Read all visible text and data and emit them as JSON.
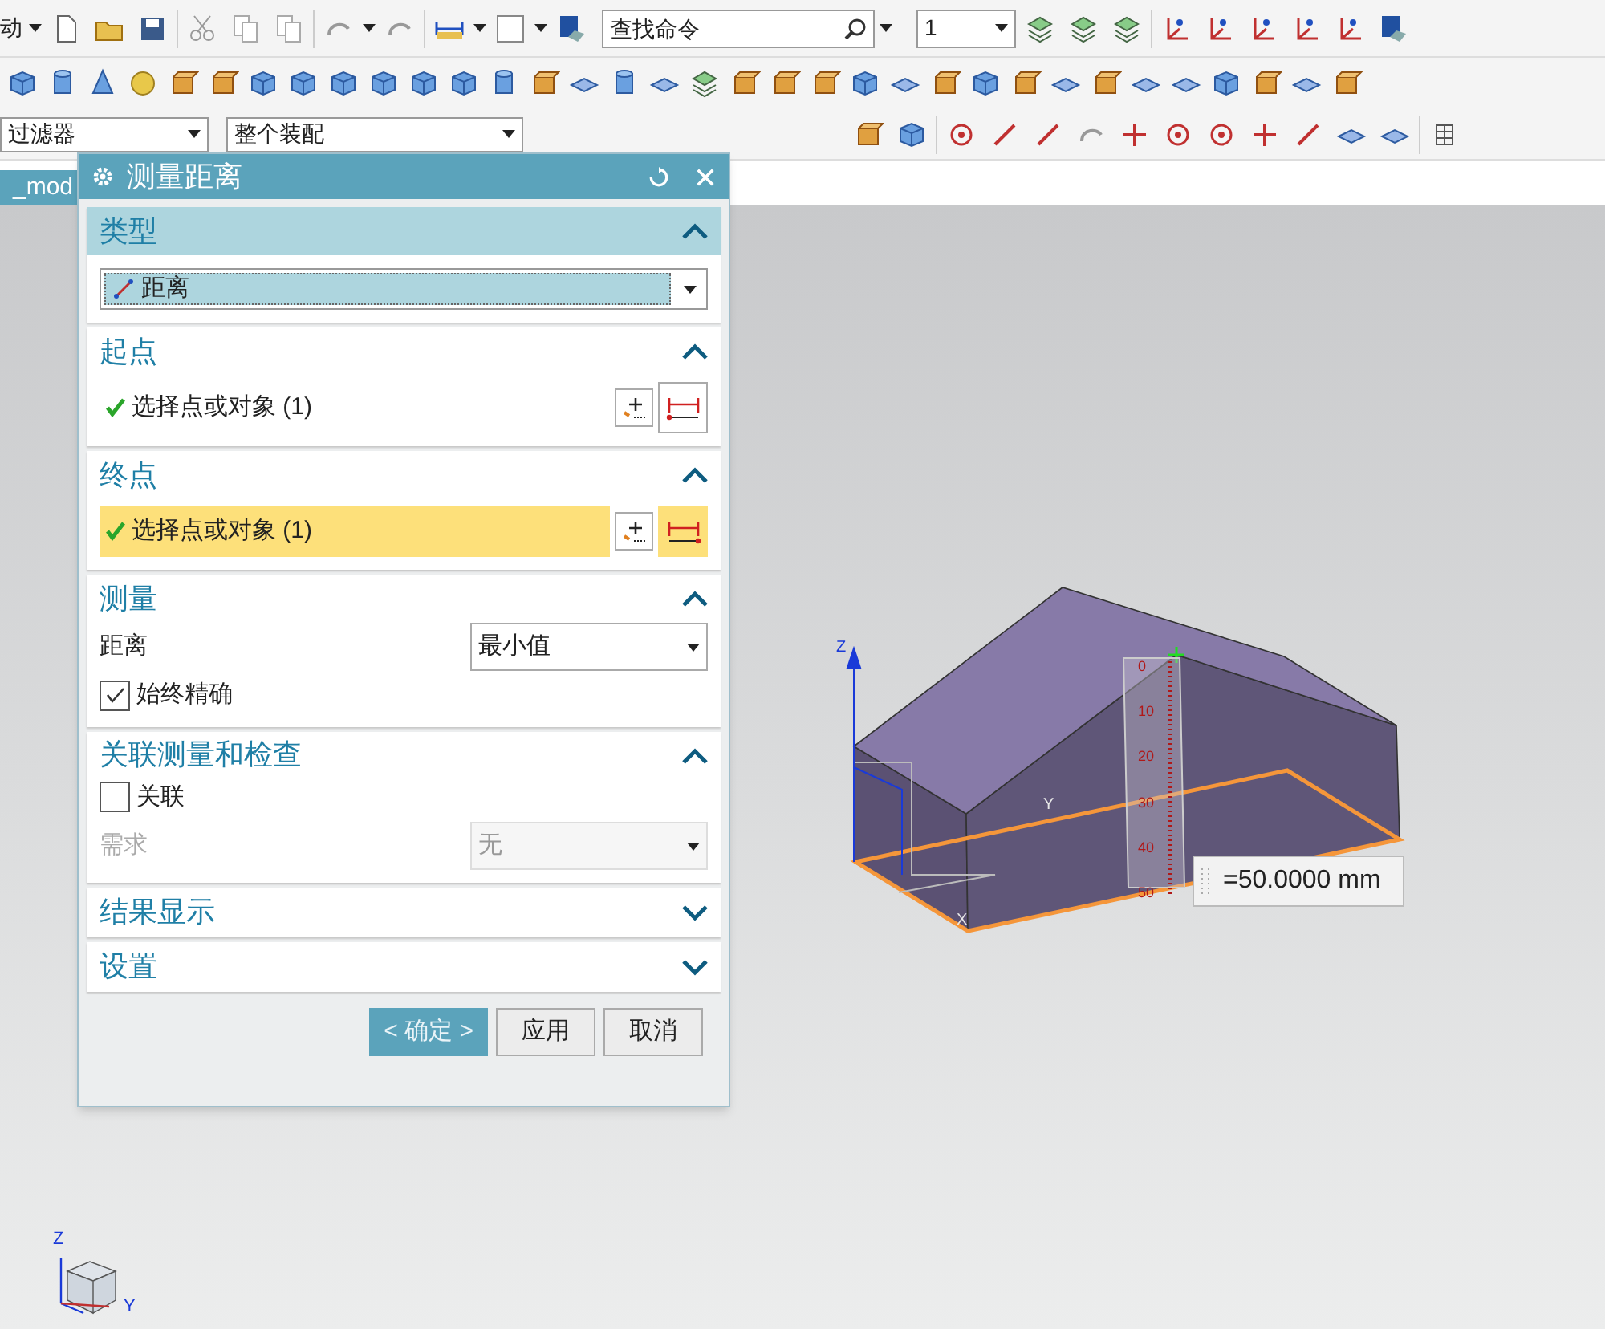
{
  "toolbar": {
    "menu_label": "动",
    "search": {
      "placeholder": "查找命令"
    },
    "layer_value": "1"
  },
  "filter_bar": {
    "filter": "过滤器",
    "scope": "整个装配"
  },
  "tab": {
    "label": "_mod"
  },
  "dialog": {
    "title": "测量距离",
    "sections": [
      {
        "kind": "type",
        "title": "类型",
        "expanded": true,
        "highlighted": true,
        "value": "距离"
      },
      {
        "kind": "select",
        "title": "起点",
        "expanded": true,
        "highlighted": false,
        "label": "选择点或对象 (1)",
        "active": false
      },
      {
        "kind": "select",
        "title": "终点",
        "expanded": true,
        "highlighted": false,
        "label": "选择点或对象 (1)",
        "active": true
      },
      {
        "kind": "measure",
        "title": "测量",
        "expanded": true,
        "highlighted": false,
        "distance_label": "距离",
        "distance_value": "最小值",
        "option": {
          "label": "始终精确",
          "checked": true
        }
      },
      {
        "kind": "assoc",
        "title": "关联测量和检查",
        "expanded": true,
        "highlighted": false,
        "option": {
          "label": "关联",
          "checked": false
        },
        "requirement": {
          "label": "需求",
          "value": "无",
          "disabled": true
        }
      },
      {
        "kind": "collapsed",
        "title": "结果显示",
        "expanded": false,
        "highlighted": false
      },
      {
        "kind": "collapsed",
        "title": "设置",
        "expanded": false,
        "highlighted": false
      }
    ],
    "buttons": [
      {
        "label": "< 确定 >",
        "primary": true
      },
      {
        "label": "应用",
        "primary": false
      },
      {
        "label": "取消",
        "primary": false
      }
    ]
  },
  "viewport": {
    "measurement": "=50.0000 mm",
    "ruler_labels": [
      "0",
      "10",
      "20",
      "30",
      "40",
      "50"
    ],
    "axis_labels": [
      "Z",
      "Y",
      "X"
    ],
    "triad_labels": [
      "Z",
      "Y"
    ]
  }
}
